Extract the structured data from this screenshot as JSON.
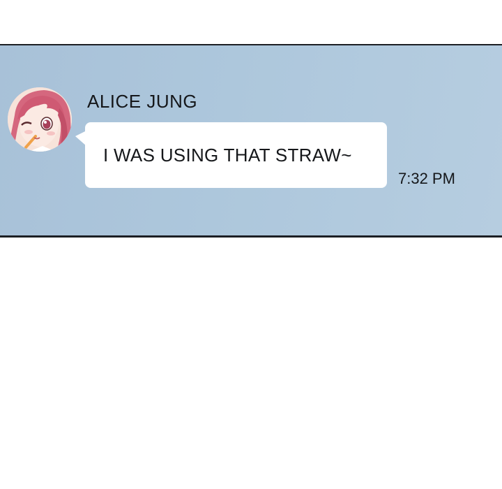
{
  "chat": {
    "sender_name": "ALICE JUNG",
    "message_text": "I WAS USING THAT STRAW~",
    "timestamp": "7:32 PM",
    "avatar_icon": "profile-avatar-icon"
  },
  "colors": {
    "panel_background": "#adc7dc",
    "bubble": "#ffffff",
    "text": "#15171a",
    "border": "#1c1f24"
  }
}
